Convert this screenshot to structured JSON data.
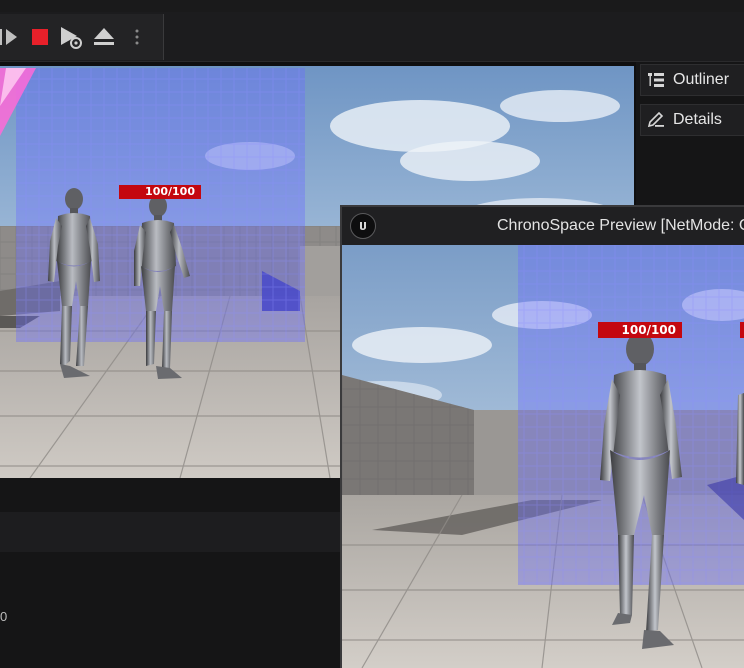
{
  "toolbar": {
    "buttons": [
      {
        "name": "skip-forward-icon"
      },
      {
        "name": "stop-icon",
        "color": "#e8202a"
      },
      {
        "name": "simulate-icon"
      },
      {
        "name": "eject-icon"
      },
      {
        "name": "more-options-icon"
      }
    ]
  },
  "panels": {
    "outliner_label": "Outliner",
    "details_label": "Details"
  },
  "viewport": {
    "health_label": "100/100"
  },
  "preview": {
    "title": "ChronoSpace Preview [NetMode: C",
    "health_label": "100/100"
  },
  "log": {
    "visible_digit": "0"
  },
  "colors": {
    "health_bar": "#c4070f",
    "volume_overlay": "#6a6cff",
    "accent_pink": "#ff6ad8"
  }
}
